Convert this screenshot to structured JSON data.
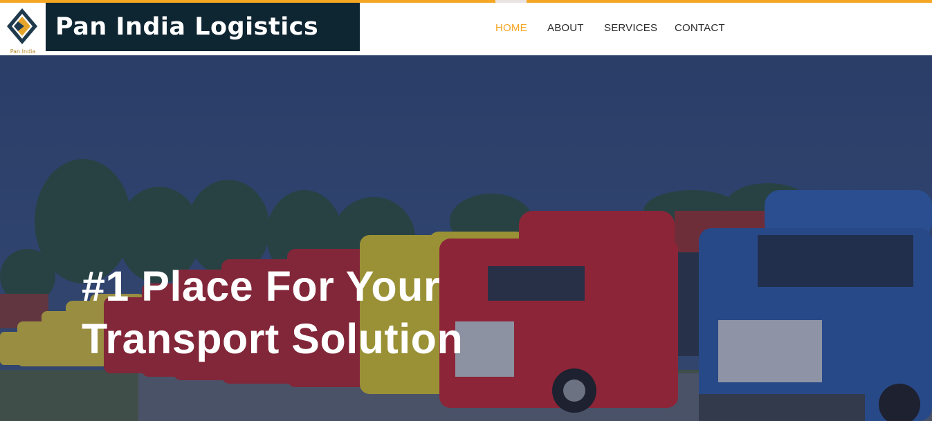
{
  "brand": {
    "name": "Pan India Logistics",
    "mark_caption": "Pan India",
    "accent_color": "#f5a623",
    "dark_color": "#0e2532"
  },
  "nav": {
    "items": [
      {
        "label": "HOME",
        "active": true
      },
      {
        "label": "ABOUT",
        "active": false
      },
      {
        "label": "SERVICES",
        "active": false
      },
      {
        "label": "CONTACT",
        "active": false
      }
    ]
  },
  "hero": {
    "title_line1": "#1 Place For Your",
    "title_line2": "Transport Solution",
    "background": "photo-row-of-trucks"
  }
}
